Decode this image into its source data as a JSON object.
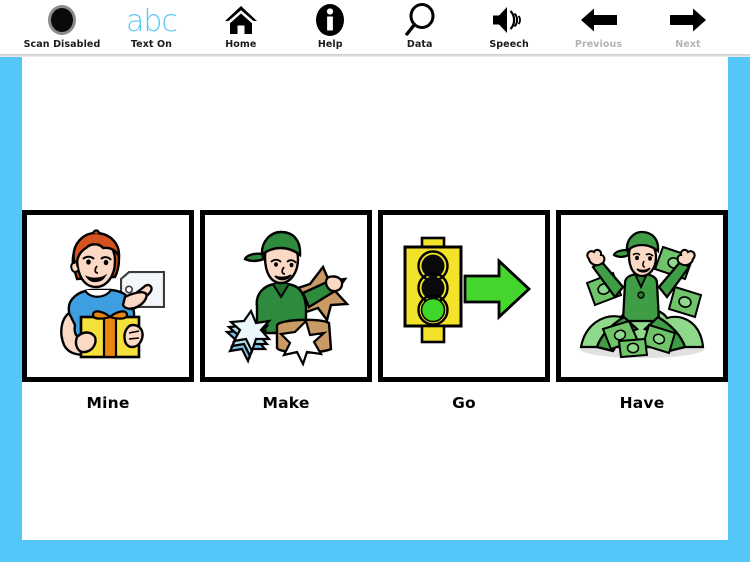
{
  "app": {
    "accent_blue": "#55C6F8",
    "text_icon_blue": "#5BC8F5",
    "background": "#FFFFFF",
    "card_border": "#000000"
  },
  "toolbar": {
    "items": [
      {
        "label": "Scan Disabled",
        "icon": "scan-circle-icon",
        "enabled": true
      },
      {
        "label": "Text On",
        "icon": "abc-text-icon",
        "glyph_text": "abc",
        "enabled": true
      },
      {
        "label": "Home",
        "icon": "home-icon",
        "enabled": true
      },
      {
        "label": "Help",
        "icon": "info-circle-icon",
        "enabled": true
      },
      {
        "label": "Data",
        "icon": "magnifier-icon",
        "enabled": true
      },
      {
        "label": "Speech",
        "icon": "speaker-icon",
        "enabled": true
      },
      {
        "label": "Previous",
        "icon": "arrow-left-icon",
        "enabled": false
      },
      {
        "label": "Next",
        "icon": "arrow-right-icon",
        "enabled": false
      }
    ]
  },
  "board": {
    "cells": [
      {
        "label": "Mine",
        "symbol": "boy-holding-gift-with-tag"
      },
      {
        "label": "Make",
        "symbol": "person-making-star-cookies"
      },
      {
        "label": "Go",
        "symbol": "traffic-light-green-with-arrow"
      },
      {
        "label": "Have",
        "symbol": "person-sitting-on-money-pile"
      }
    ]
  }
}
